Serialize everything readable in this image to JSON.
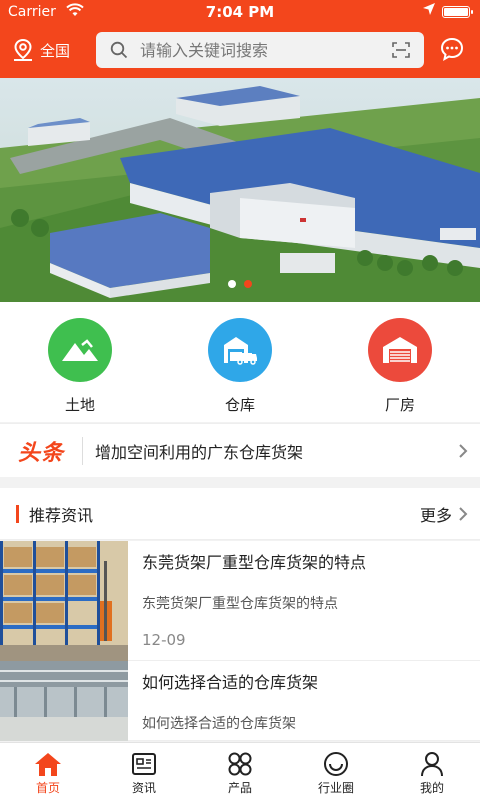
{
  "status_bar": {
    "carrier": "Carrier",
    "time": "7:04 PM"
  },
  "header": {
    "region": "全国",
    "search_placeholder": "请输入关键词搜索"
  },
  "banner": {
    "slides": 2,
    "active_slide": 2
  },
  "categories": [
    {
      "label": "土地",
      "icon": "mountain-icon",
      "color": "#3fbf4f"
    },
    {
      "label": "仓库",
      "icon": "warehouse-truck-icon",
      "color": "#2fa7e8"
    },
    {
      "label": "厂房",
      "icon": "factory-garage-icon",
      "color": "#ec4a3c"
    }
  ],
  "headline": {
    "logo": "头条",
    "text": "增加空间利用的广东仓库货架"
  },
  "recommend": {
    "title": "推荐资讯",
    "more": "更多",
    "items": [
      {
        "title": "东莞货架厂重型仓库货架的特点",
        "desc": "东莞货架厂重型仓库货架的特点",
        "date": "12-09"
      },
      {
        "title": "如何选择合适的仓库货架",
        "desc": "如何选择合适的仓库货架"
      }
    ]
  },
  "tabbar": [
    {
      "label": "首页",
      "icon": "home-icon",
      "active": true
    },
    {
      "label": "资讯",
      "icon": "news-icon",
      "active": false
    },
    {
      "label": "产品",
      "icon": "products-icon",
      "active": false
    },
    {
      "label": "行业圈",
      "icon": "smile-icon",
      "active": false
    },
    {
      "label": "我的",
      "icon": "user-icon",
      "active": false
    }
  ],
  "colors": {
    "brand": "#f3461c",
    "land": "#3fbf4f",
    "warehouse": "#2fa7e8",
    "factory": "#ec4a3c"
  }
}
